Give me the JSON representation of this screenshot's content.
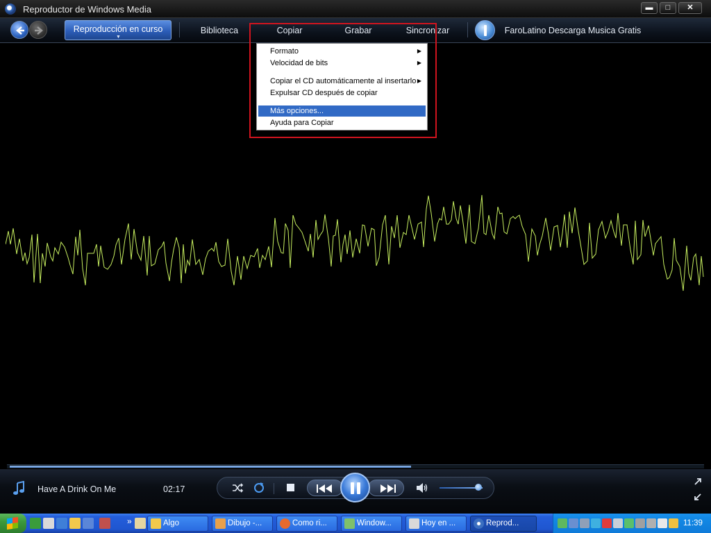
{
  "window": {
    "title": "Reproductor de Windows Media",
    "min_label": "▬",
    "max_label": "□",
    "close_label": "✕"
  },
  "nav": {
    "tabs": [
      {
        "label": "Reproducción en curso",
        "active": true
      },
      {
        "label": "Biblioteca"
      },
      {
        "label": "Copiar"
      },
      {
        "label": "Grabar"
      },
      {
        "label": "Sincronizar"
      }
    ],
    "store_label": "FaroLatino Descarga Musica Gratis"
  },
  "menu": {
    "items": [
      {
        "label": "Formato",
        "submenu": true
      },
      {
        "label": "Velocidad de bits",
        "submenu": true
      },
      {
        "label": "Copiar el CD automáticamente al insertarlo",
        "submenu": true
      },
      {
        "label": "Expulsar CD después de copiar"
      },
      {
        "label": "Más opciones...",
        "highlighted": true
      },
      {
        "label": "Ayuda para Copiar"
      }
    ]
  },
  "player": {
    "track_title": "Have A Drink On Me",
    "elapsed_time": "02:17",
    "seek_progress": 0.58,
    "volume_level": 0.9
  },
  "taskbar": {
    "tasks": [
      {
        "label": "Algo"
      },
      {
        "label": "Dibujo -..."
      },
      {
        "label": "Como ri..."
      },
      {
        "label": "Window..."
      },
      {
        "label": "Hoy en ..."
      },
      {
        "label": "Reprod...",
        "active": true
      }
    ],
    "overflow_label": "»",
    "clock": "11:39"
  },
  "colors": {
    "accent": "#316ac5",
    "highlight_border": "#d0141e",
    "waveform": "#c8f060"
  },
  "icons": [
    "player-logo-icon",
    "back-arrow-icon",
    "forward-arrow-icon",
    "info-icon",
    "music-note-icon",
    "shuffle-icon",
    "repeat-icon",
    "stop-icon",
    "previous-icon",
    "pause-icon",
    "next-icon",
    "volume-icon",
    "compact-mode-icon",
    "fullscreen-icon",
    "windows-logo-icon"
  ]
}
